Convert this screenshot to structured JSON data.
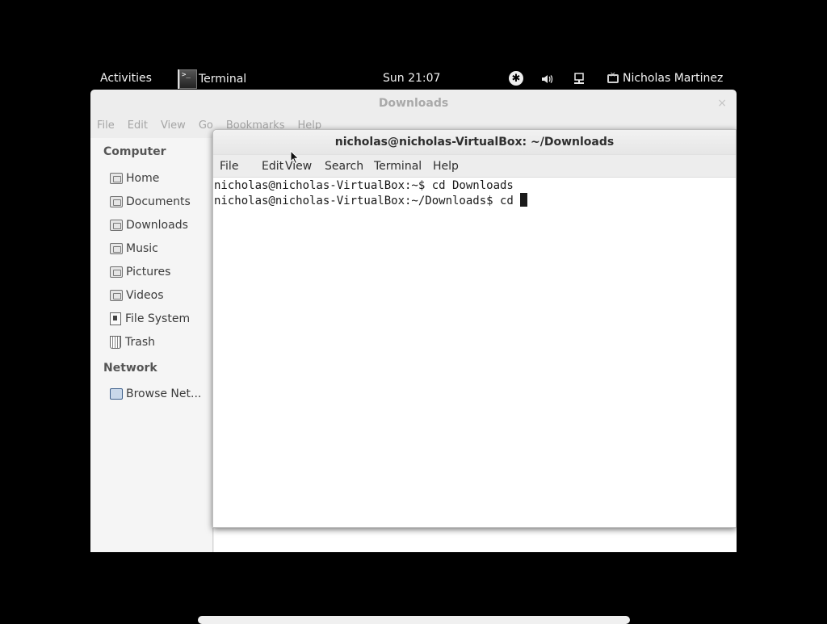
{
  "top_bar": {
    "activities_label": "Activities",
    "app_icon_glyph": ">_",
    "app_name": "Terminal",
    "clock": "Sun 21:07",
    "accessibility_icon_glyph": "✱",
    "user_name": "Nicholas Martinez"
  },
  "files_window": {
    "title": "Downloads",
    "close_glyph": "×",
    "menu": [
      "File",
      "Edit",
      "View",
      "Go",
      "Bookmarks",
      "Help"
    ],
    "sidebar": {
      "computer_heading": "Computer",
      "items": [
        "Home",
        "Documents",
        "Downloads",
        "Music",
        "Pictures",
        "Videos",
        "File System",
        "Trash"
      ],
      "network_heading": "Network",
      "network_items": [
        "Browse Net..."
      ]
    }
  },
  "terminal_window": {
    "title": "nicholas@nicholas-VirtualBox: ~/Downloads",
    "menu": [
      "File",
      "Edit",
      "View",
      "Search",
      "Terminal",
      "Help"
    ],
    "lines": [
      "nicholas@nicholas-VirtualBox:~$ cd Downloads",
      "nicholas@nicholas-VirtualBox:~/Downloads$ cd "
    ]
  },
  "colors": {
    "desktop_background": "#000000",
    "top_bar_text": "#f2f2f2",
    "window_background": "#ededed",
    "terminal_background": "#ffffff",
    "terminal_text": "#1a1a1a"
  }
}
